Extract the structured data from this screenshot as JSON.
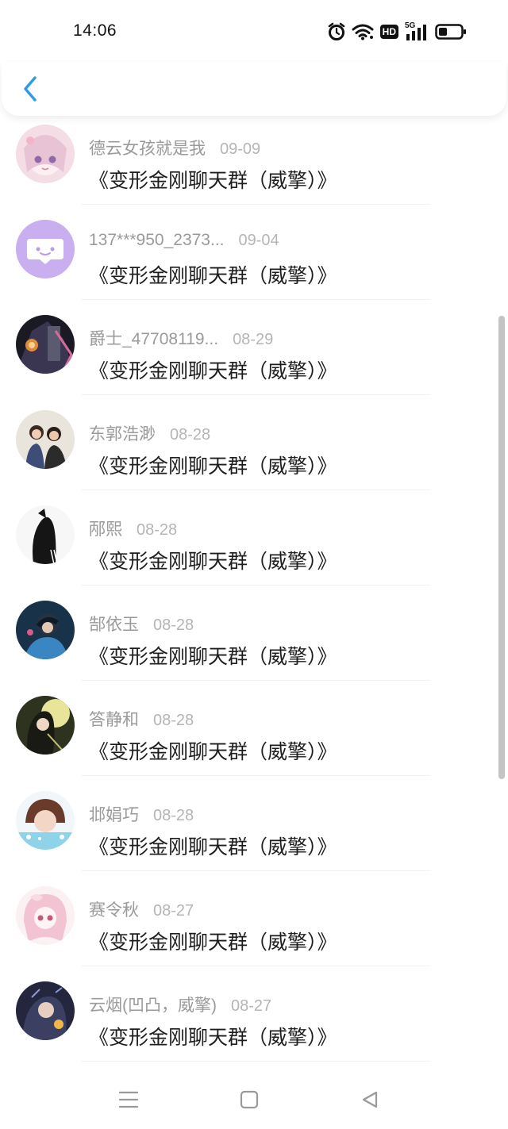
{
  "status_bar": {
    "time": "14:06",
    "icons": [
      "alarm-icon",
      "wifi-icon",
      "hd-icon",
      "signal-5g-icon",
      "battery-icon"
    ],
    "hd_label": "HD",
    "net_label": "5G"
  },
  "header": {
    "back_icon": "chevron-left-icon",
    "accent": "#2f9be8"
  },
  "list": {
    "items": [
      {
        "name": "德云女孩就是我",
        "date": "09-09",
        "title": "《变形金刚聊天群（威擎）》"
      },
      {
        "name": "137***950_2373...",
        "date": "09-04",
        "title": "《变形金刚聊天群（威擎）》"
      },
      {
        "name": "爵士_47708119...",
        "date": "08-29",
        "title": "《变形金刚聊天群（威擎）》"
      },
      {
        "name": "东郭浩渺",
        "date": "08-28",
        "title": "《变形金刚聊天群（威擎）》"
      },
      {
        "name": "邴熙",
        "date": "08-28",
        "title": "《变形金刚聊天群（威擎）》"
      },
      {
        "name": "郜依玉",
        "date": "08-28",
        "title": "《变形金刚聊天群（威擎）》"
      },
      {
        "name": "答静和",
        "date": "08-28",
        "title": "《变形金刚聊天群（威擎）》"
      },
      {
        "name": "邶娟巧",
        "date": "08-28",
        "title": "《变形金刚聊天群（威擎）》"
      },
      {
        "name": "赛令秋",
        "date": "08-27",
        "title": "《变形金刚聊天群（威擎）》"
      },
      {
        "name": "云烟(凹凸，威擎)",
        "date": "08-27",
        "title": "《变形金刚聊天群（威擎）》"
      }
    ]
  },
  "nav": {
    "icons": [
      "menu-icon",
      "home-square-icon",
      "back-triangle-icon"
    ]
  }
}
